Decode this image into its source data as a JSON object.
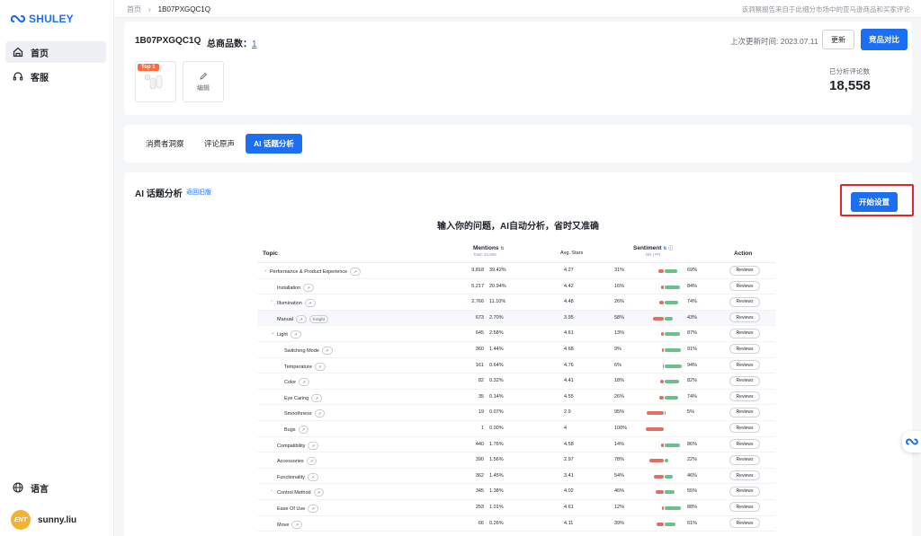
{
  "brand": {
    "name": "SHULEY",
    "accent": "#1d6ff2",
    "highlight": "#e02828"
  },
  "sidebar": {
    "items": [
      {
        "label": "首页",
        "icon": "home-icon",
        "active": true
      },
      {
        "label": "客服",
        "icon": "headset-icon",
        "active": false
      }
    ],
    "language": {
      "label": "语言",
      "icon": "globe-icon"
    },
    "user": {
      "avatar_text": "ENT",
      "name": "sunny.liu"
    }
  },
  "topbar": {
    "breadcrumb": [
      "首页",
      "1B07PXGQC1Q"
    ],
    "notice": "该洞察报告来自于此细分市场中的亚马逊商品和买家评论"
  },
  "product": {
    "id": "1B07PXGQC1Q",
    "total_label": "总商品数：",
    "total_count": "1",
    "badge": "Top 1",
    "edit_label": "编辑",
    "last_update": "上次更新时间: 2023.07.11",
    "update_btn": "更新",
    "compare_btn": "竞品对比",
    "analyzed_label": "已分析评论数",
    "analyzed_count": "18,558"
  },
  "tabs": [
    "消费者洞察",
    "评论原声",
    "AI 话题分析"
  ],
  "ai": {
    "title": "AI 话题分析",
    "back_link": "返回旧版",
    "start_btn": "开始设置",
    "headline": "输入你的问题，AI自动分析，省时又准确"
  },
  "table": {
    "headers": {
      "topic": "Topic",
      "mentions": "Mentions",
      "mentions_sub": "Total: 24,905",
      "stars": "Avg. Stars",
      "sentiment": "Sentiment",
      "sentiment_sub": "NR | PR",
      "action": "Action"
    },
    "rows": [
      {
        "topic": "Performance & Product Experience",
        "tags": [
          "↗"
        ],
        "level": 0,
        "expand": "⌄",
        "mentions": "9,818",
        "pct": "39.42%",
        "stars": "4.27",
        "neg": "31%",
        "pos": "69%",
        "negv": 31,
        "posv": 69
      },
      {
        "topic": "Installation",
        "tags": [
          "↗"
        ],
        "level": 1,
        "expand": "",
        "mentions": "5,217",
        "pct": "20.94%",
        "stars": "4.42",
        "neg": "16%",
        "pos": "84%",
        "negv": 16,
        "posv": 84
      },
      {
        "topic": "Illumination",
        "tags": [
          "↗"
        ],
        "level": 1,
        "expand": "›",
        "mentions": "2,766",
        "pct": "11.10%",
        "stars": "4.48",
        "neg": "26%",
        "pos": "74%",
        "negv": 26,
        "posv": 74
      },
      {
        "topic": "Manual",
        "tags": [
          "↗",
          "Insight"
        ],
        "level": 1,
        "expand": "",
        "mentions": "673",
        "pct": "2.70%",
        "stars": "3.95",
        "neg": "58%",
        "pos": "43%",
        "negv": 58,
        "posv": 43
      },
      {
        "topic": "Light",
        "tags": [
          "↗"
        ],
        "level": 1,
        "expand": "⌄",
        "mentions": "645",
        "pct": "2.58%",
        "stars": "4.61",
        "neg": "13%",
        "pos": "87%",
        "negv": 13,
        "posv": 87
      },
      {
        "topic": "Switching Mode",
        "tags": [
          "↗"
        ],
        "level": 2,
        "expand": "",
        "mentions": "360",
        "pct": "1.44%",
        "stars": "4.68",
        "neg": "9%",
        "pos": "91%",
        "negv": 9,
        "posv": 91
      },
      {
        "topic": "Temperature",
        "tags": [
          "↗"
        ],
        "level": 2,
        "expand": "",
        "mentions": "161",
        "pct": "0.64%",
        "stars": "4.76",
        "neg": "6%",
        "pos": "94%",
        "negv": 6,
        "posv": 94
      },
      {
        "topic": "Color",
        "tags": [
          "↗"
        ],
        "level": 2,
        "expand": "",
        "mentions": "82",
        "pct": "0.32%",
        "stars": "4.41",
        "neg": "18%",
        "pos": "82%",
        "negv": 18,
        "posv": 82
      },
      {
        "topic": "Eye Caring",
        "tags": [
          "↗"
        ],
        "level": 2,
        "expand": "",
        "mentions": "35",
        "pct": "0.14%",
        "stars": "4.55",
        "neg": "26%",
        "pos": "74%",
        "negv": 26,
        "posv": 74
      },
      {
        "topic": "Smoothness",
        "tags": [
          "↗"
        ],
        "level": 2,
        "expand": "",
        "mentions": "19",
        "pct": "0.07%",
        "stars": "2.9",
        "neg": "95%",
        "pos": "5%",
        "negv": 95,
        "posv": 5
      },
      {
        "topic": "Bugs",
        "tags": [
          "↗"
        ],
        "level": 2,
        "expand": "",
        "mentions": "1",
        "pct": "0.00%",
        "stars": "4",
        "neg": "100%",
        "pos": "",
        "negv": 100,
        "posv": 0
      },
      {
        "topic": "Compatibility",
        "tags": [
          "↗"
        ],
        "level": 1,
        "expand": "",
        "mentions": "440",
        "pct": "1.76%",
        "stars": "4.58",
        "neg": "14%",
        "pos": "86%",
        "negv": 14,
        "posv": 86
      },
      {
        "topic": "Accessories",
        "tags": [
          "↗"
        ],
        "level": 1,
        "expand": "",
        "mentions": "390",
        "pct": "1.56%",
        "stars": "2.97",
        "neg": "78%",
        "pos": "22%",
        "negv": 78,
        "posv": 22
      },
      {
        "topic": "Functionality",
        "tags": [
          "↗"
        ],
        "level": 1,
        "expand": "",
        "mentions": "362",
        "pct": "1.45%",
        "stars": "3.41",
        "neg": "54%",
        "pos": "46%",
        "negv": 54,
        "posv": 46
      },
      {
        "topic": "Control Method",
        "tags": [
          "↗"
        ],
        "level": 1,
        "expand": "›",
        "mentions": "345",
        "pct": "1.38%",
        "stars": "4.02",
        "neg": "46%",
        "pos": "55%",
        "negv": 46,
        "posv": 55
      },
      {
        "topic": "Ease Of Use",
        "tags": [
          "↗"
        ],
        "level": 1,
        "expand": "",
        "mentions": "253",
        "pct": "1.01%",
        "stars": "4.61",
        "neg": "12%",
        "pos": "88%",
        "negv": 12,
        "posv": 88
      },
      {
        "topic": "Move",
        "tags": [
          "↗"
        ],
        "level": 1,
        "expand": "",
        "mentions": "66",
        "pct": "0.26%",
        "stars": "4.11",
        "neg": "39%",
        "pos": "61%",
        "negv": 39,
        "posv": 61
      }
    ],
    "action_label": "Reviews"
  }
}
